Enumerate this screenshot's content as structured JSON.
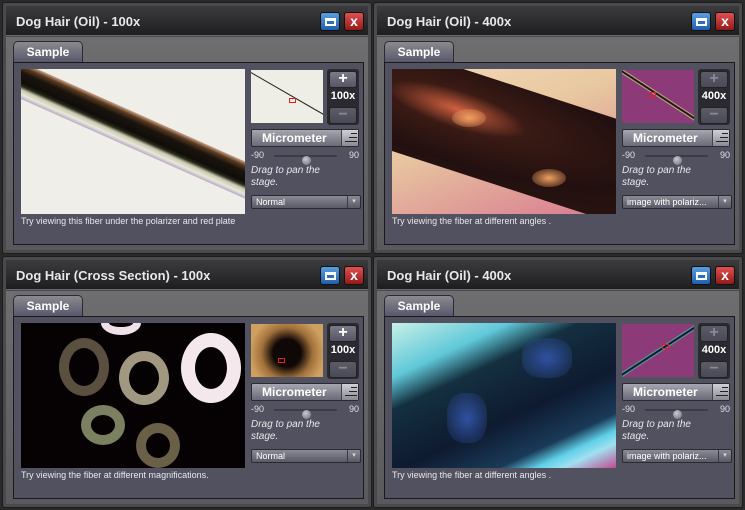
{
  "windows": [
    {
      "title": "Dog Hair (Oil) - 100x",
      "tab": "Sample",
      "magnification": "100x",
      "zoom_in_enabled": true,
      "zoom_out_enabled": false,
      "measure_button": "Micrometer",
      "slider": {
        "min": "-90",
        "max": "90",
        "value": 0
      },
      "hint": "Drag to pan the stage.",
      "select_value": "Normal",
      "caption": "Try viewing this fiber under the polarizer and red plate",
      "image": "dog-hair-brightfield-100x",
      "thumbnail": "dog-hair-overview-brightfield"
    },
    {
      "title": "Dog Hair (Oil) - 400x",
      "tab": "Sample",
      "magnification": "400x",
      "zoom_in_enabled": false,
      "zoom_out_enabled": false,
      "measure_button": "Micrometer",
      "slider": {
        "min": "-90",
        "max": "90",
        "value": 0
      },
      "hint": "Drag to pan the stage.",
      "select_value": "image with polariz...",
      "caption": "Try viewing the fiber at different angles .",
      "image": "dog-hair-polarized-400x",
      "thumbnail": "dog-hair-overview-red-plate"
    },
    {
      "title": "Dog Hair (Cross Section) - 100x",
      "tab": "Sample",
      "magnification": "100x",
      "zoom_in_enabled": true,
      "zoom_out_enabled": false,
      "measure_button": "Micrometer",
      "slider": {
        "min": "-90",
        "max": "90",
        "value": 0
      },
      "hint": "Drag to pan the stage.",
      "select_value": "Normal",
      "caption": "Try viewing the fiber at different magnifications.",
      "image": "dog-hair-cross-section-100x",
      "thumbnail": "dog-hair-cross-section-overview"
    },
    {
      "title": "Dog Hair (Oil) - 400x",
      "tab": "Sample",
      "magnification": "400x",
      "zoom_in_enabled": false,
      "zoom_out_enabled": false,
      "measure_button": "Micrometer",
      "slider": {
        "min": "-90",
        "max": "90",
        "value": 0
      },
      "hint": "Drag to pan the stage.",
      "select_value": "image with polariz...",
      "caption": "Try viewing the fiber at different angles .",
      "image": "dog-hair-polarized-400x-blue",
      "thumbnail": "dog-hair-overview-red-plate-rotated"
    }
  ],
  "icons": {
    "maximize": "window-maximize-icon",
    "close": "x",
    "zoom_in": "+",
    "zoom_out": "−",
    "dropdown": "▾"
  },
  "colors": {
    "maximize_button": "#2c6fbe",
    "close_button": "#b02020",
    "stage_marker": "#e02020"
  }
}
